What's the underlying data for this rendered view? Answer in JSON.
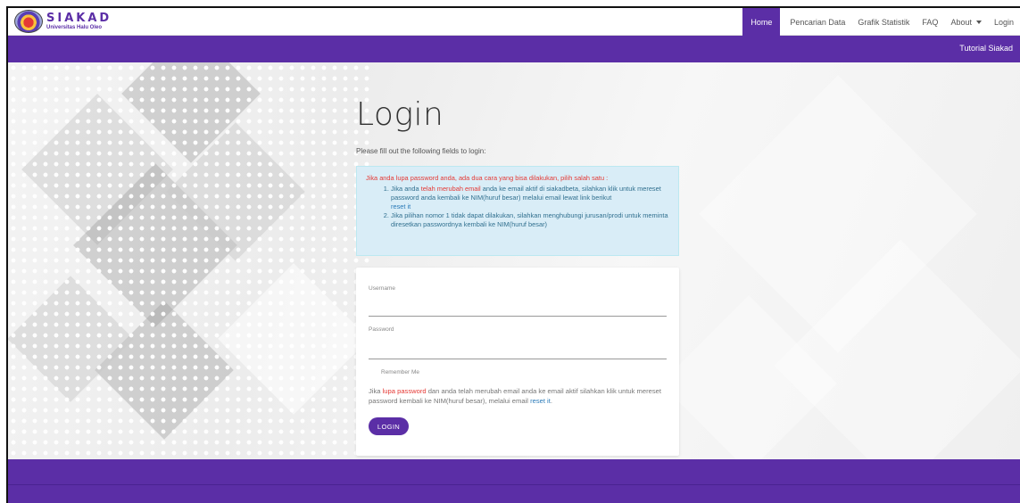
{
  "brand": {
    "title": "SIAKAD",
    "subtitle": "Universitas Halu Oleo"
  },
  "nav": {
    "items": [
      {
        "label": "Home",
        "active": true
      },
      {
        "label": "Pencarian Data"
      },
      {
        "label": "Grafik Statistik"
      },
      {
        "label": "FAQ"
      },
      {
        "label": "About",
        "dropdown": true
      },
      {
        "label": "Login"
      }
    ]
  },
  "subbar": {
    "link": "Tutorial Siakad"
  },
  "page": {
    "title": "Login",
    "intro": "Please fill out the following fields to login:"
  },
  "alert": {
    "intro": "Jika anda lupa password anda, ada dua cara yang bisa dilakukan, pilih salah satu :",
    "item1_a": "Jika anda ",
    "item1_highlight": "telah merubah email",
    "item1_b": " anda ke email aktif di siakadbeta, silahkan klik untuk mereset password anda kembali ke NIM(huruf besar) melalui email lewat link berikut",
    "item1_link": "reset it",
    "item2": "Jika pilihan nomor 1 tidak dapat dilakukan, silahkan menghubungi jurusan/prodi untuk meminta diresetkan passwordnya kembali ke NIM(huruf besar)"
  },
  "form": {
    "username_label": "Username",
    "username_value": "",
    "password_label": "Password",
    "password_value": "",
    "remember_label": "Remember Me",
    "note_a": "Jika ",
    "note_highlight": "lupa password",
    "note_b": " dan anda telah merubah email anda ke email aktif silahkan klik untuk mereset password kembali ke NIM(huruf besar), melalui email ",
    "note_link": "reset it",
    "note_end": ".",
    "login_button": "LOGIN"
  },
  "colors": {
    "brand": "#5b2ea6",
    "alert_bg": "#d9edf7",
    "highlight": "#e53935",
    "link": "#2a7ab8"
  }
}
